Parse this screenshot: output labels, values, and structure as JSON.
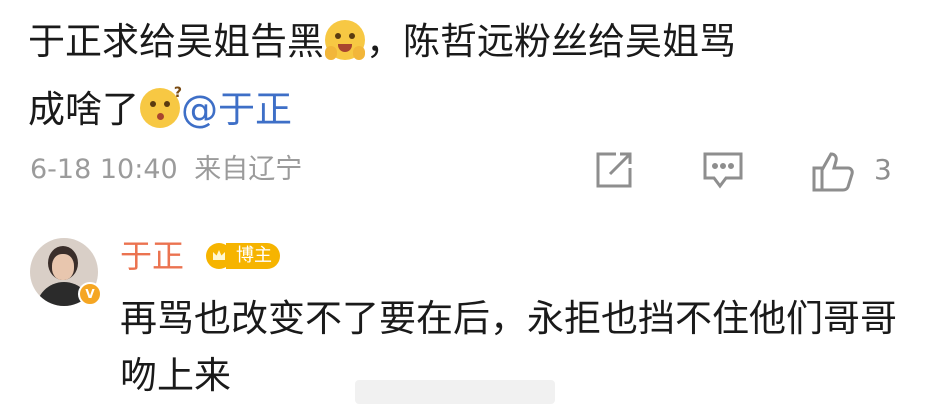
{
  "post": {
    "text_part1": "于正求给吴姐告黑",
    "text_part2": "，陈哲远粉丝给吴姐骂",
    "text_part3": "成啥了",
    "mention": "@于正",
    "emoji1": "smile-hands-emoji",
    "emoji2": "confused-emoji"
  },
  "meta": {
    "timestamp": "6-18 10:40",
    "source": "来自辽宁",
    "like_count": "3"
  },
  "icons": {
    "share": "share-icon",
    "comment": "comment-icon",
    "like": "thumbs-up-icon"
  },
  "comment": {
    "username": "于正",
    "badge_label": "博主",
    "text": "再骂也改变不了要在后，永拒也挡不住他们哥哥吻上来"
  },
  "colors": {
    "username": "#eb7350",
    "mention": "#3e6fc7",
    "meta": "#9b9b9b",
    "badge": "#f6b400"
  }
}
